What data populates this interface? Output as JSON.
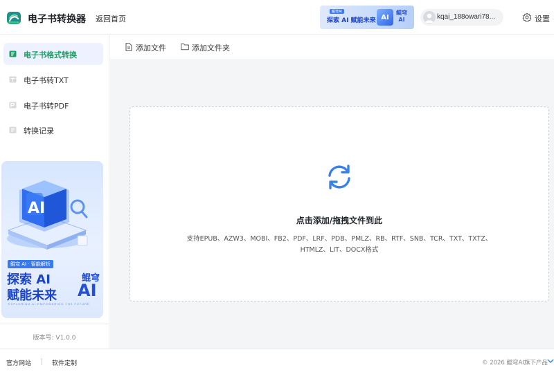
{
  "header": {
    "app_title": "电子书转换器",
    "home_link": "返回首页",
    "ad": {
      "tag": "鲲穹AI",
      "text": "探索 AI 赋能未来",
      "cube_text": "AI",
      "brand_line1": "鲲穹",
      "brand_line2": "AI"
    },
    "user_name": "kqai_188owari78...",
    "settings_label": "设置"
  },
  "sidebar": {
    "items": [
      {
        "label": "电子书格式转换",
        "icon": "book-convert-icon",
        "active": true
      },
      {
        "label": "电子书转TXT",
        "icon": "txt-file-icon",
        "active": false
      },
      {
        "label": "电子书转PDF",
        "icon": "pdf-file-icon",
        "active": false
      },
      {
        "label": "转换记录",
        "icon": "history-icon",
        "active": false
      }
    ],
    "banner": {
      "cube_text": "AI",
      "tag": "鲲穹 AI · 智能解析",
      "line1": "探索 AI",
      "line2": "赋能未来",
      "brand_top": "鲲穹",
      "brand_ai": "AI",
      "subtitle": "EXPLORING AI EMPOWERING THE FUTURE"
    },
    "version": "版本号: V1.0.0"
  },
  "toolbar": {
    "add_file": "添加文件",
    "add_folder": "添加文件夹"
  },
  "dropzone": {
    "title": "点击添加/拖拽文件到此",
    "formats": "支持EPUB、AZW3、MOBI、FB2、PDF、LRF、PDB、PMLZ、RB、RTF、SNB、TCR、TXT、TXTZ、HTMLZ、LIT、DOCX格式"
  },
  "footer": {
    "official_site": "官方网站",
    "custom_software": "软件定制",
    "copyright": "© 2026 鲲穹AI旗下产品"
  },
  "colors": {
    "accent_green": "#1e9e62",
    "active_bg": "#eef1ff",
    "refresh_icon": "#3b82e6",
    "brand_blue": "#1b43c6"
  }
}
